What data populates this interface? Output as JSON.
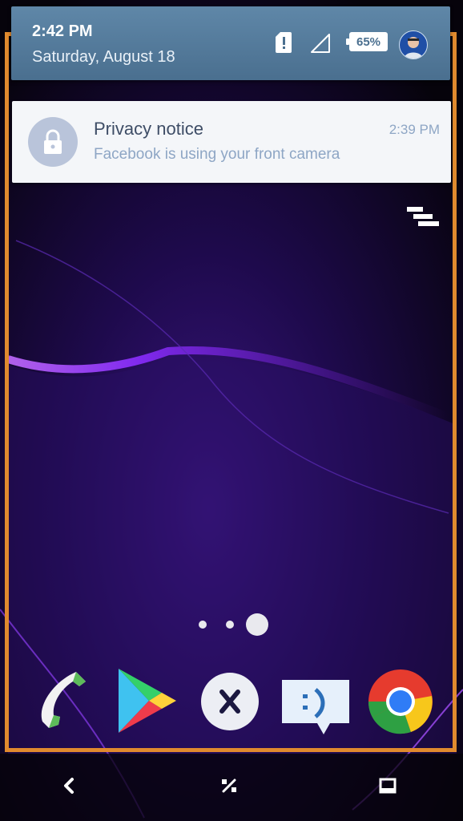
{
  "status_bar": {
    "time": "2:42 PM",
    "date": "Saturday, August 18",
    "battery_percent": "65%",
    "icons": [
      "sd-card-alert-icon",
      "signal-icon",
      "battery-icon",
      "user-avatar"
    ]
  },
  "notification": {
    "title": "Privacy notice",
    "body": "Facebook is using your front camera",
    "time": "2:39 PM",
    "icon": "lock-icon"
  },
  "home": {
    "page_count": 3,
    "active_page": 3
  },
  "dock": {
    "apps": [
      "phone-icon",
      "play-store-icon",
      "x-app-icon",
      "messaging-icon",
      "chrome-icon"
    ]
  },
  "nav_bar": {
    "buttons": [
      "back-icon",
      "home-icon",
      "recents-icon"
    ]
  },
  "colors": {
    "frame": "#e08a2e",
    "shade": "#5a7f9f",
    "card": "#f4f6f9",
    "wallpaper": "#07040c"
  }
}
